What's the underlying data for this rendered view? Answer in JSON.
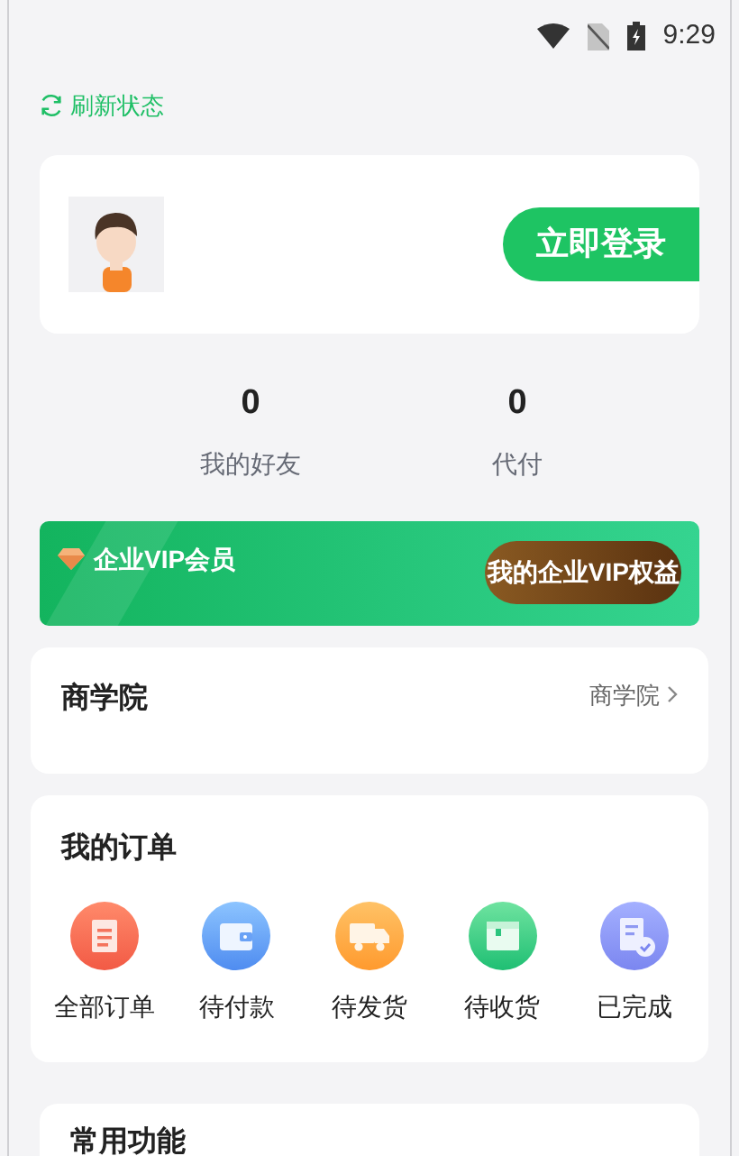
{
  "status_bar": {
    "time": "9:29"
  },
  "refresh": {
    "label": "刷新状态"
  },
  "profile": {
    "login_button": "立即登录"
  },
  "stats": [
    {
      "value": "0",
      "label": "我的好友"
    },
    {
      "value": "0",
      "label": "代付"
    }
  ],
  "vip": {
    "title": "企业VIP会员",
    "button": "我的企业VIP权益"
  },
  "academy": {
    "title": "商学院",
    "link": "商学院"
  },
  "orders": {
    "title": "我的订单",
    "items": [
      {
        "kind": "all",
        "label": "全部订单"
      },
      {
        "kind": "pay",
        "label": "待付款"
      },
      {
        "kind": "ship",
        "label": "待发货"
      },
      {
        "kind": "receive",
        "label": "待收货"
      },
      {
        "kind": "done",
        "label": "已完成"
      }
    ]
  },
  "tools": {
    "title": "常用功能"
  }
}
